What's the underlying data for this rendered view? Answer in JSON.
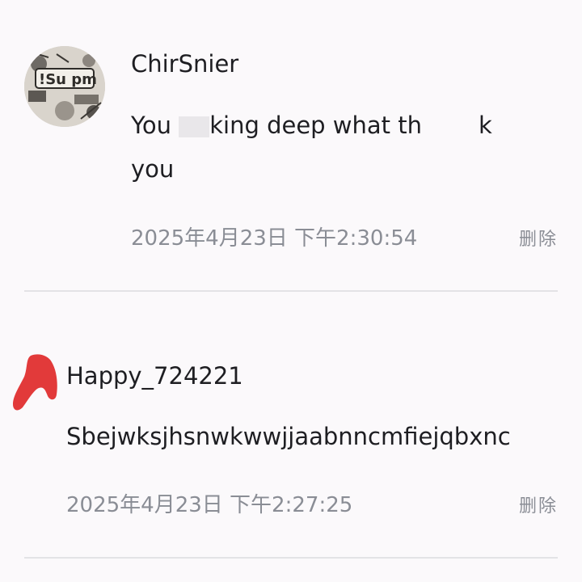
{
  "comments": [
    {
      "username": "ChirSnier",
      "text_part1": "You ",
      "text_part2": "king deep what th",
      "text_part3": "k",
      "text_line2": "you",
      "timestamp": "2025年4月23日 下午2:30:54",
      "delete_label": "删除",
      "avatar": "photo-avatar-icon"
    },
    {
      "username": "Happy_724221",
      "text": "Sbejwksjhsnwkwwjjaabnncmfiejqbxnc",
      "timestamp": "2025年4月23日 下午2:27:25",
      "delete_label": "删除",
      "avatar": "red-scribble-mark"
    }
  ],
  "colors": {
    "background": "#fbf9fb",
    "text": "#1e1e22",
    "muted": "#8a8d95",
    "divider": "#e3e3e6",
    "scribble": "#e23a3a"
  }
}
